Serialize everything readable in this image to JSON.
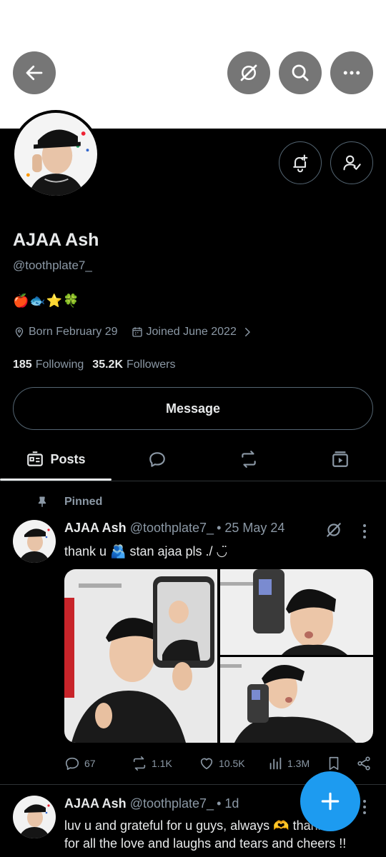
{
  "header": {
    "back_icon": "arrow-left-icon",
    "grok_icon": "grok-slash-icon",
    "search_icon": "search-icon",
    "more_icon": "more-horizontal-icon"
  },
  "profile": {
    "name": "AJAA Ash",
    "handle": "@toothplate7_",
    "bio": "🍎🐟⭐🍀",
    "born": "Born February 29",
    "joined": "Joined June 2022",
    "following_count": "185",
    "following_label": "Following",
    "followers_count": "35.2K",
    "followers_label": "Followers",
    "message_label": "Message"
  },
  "tabs": [
    {
      "label": "Posts",
      "icon": "posts-icon",
      "active": true
    },
    {
      "label": "",
      "icon": "replies-icon",
      "active": false
    },
    {
      "label": "",
      "icon": "reposts-icon",
      "active": false
    },
    {
      "label": "",
      "icon": "media-icon",
      "active": false
    }
  ],
  "posts": [
    {
      "pinned_label": "Pinned",
      "name": "AJAA Ash",
      "handle": "@toothplate7_",
      "time": "• 25 May 24",
      "text": "thank u 🫂 stan ajaa pls ./ ◡̈",
      "replies": "67",
      "reposts": "1.1K",
      "likes": "10.5K",
      "views": "1.3M"
    },
    {
      "name": "AJAA Ash",
      "handle": "@toothplate7_",
      "time": "• 1d",
      "text_line1": "luv u and grateful for u guys, always 🫶 thank u",
      "text_line2": "for all the love and laughs and tears and cheers !!"
    }
  ],
  "colors": {
    "accent": "#1d9bf0",
    "background": "#000000",
    "muted": "#8b98a5"
  }
}
